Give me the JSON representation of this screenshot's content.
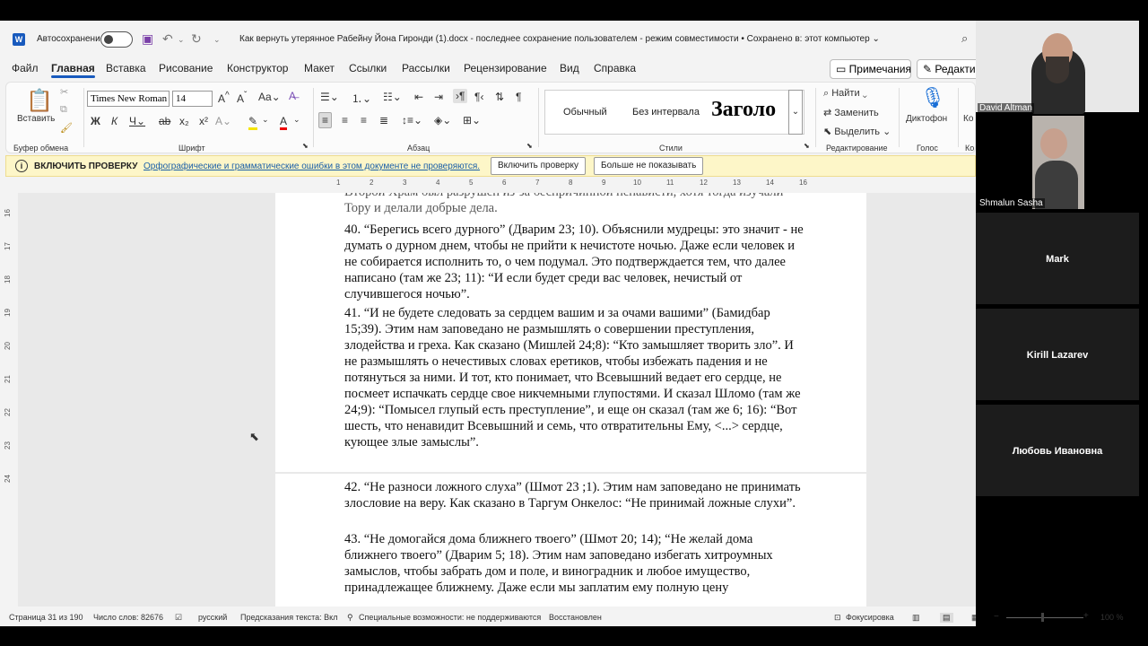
{
  "word": {
    "app_icon": "word-icon",
    "autosave_label": "Автосохранение",
    "doc_title": "Как вернуть утерянное Рабейну Йона Гиронди (1).docx  -  последнее сохранение пользователем  -  режим совместимости • Сохранено в: этот компьютер ⌄",
    "menu": [
      "Файл",
      "Главная",
      "Вставка",
      "Рисование",
      "Конструктор",
      "Макет",
      "Ссылки",
      "Рассылки",
      "Рецензирование",
      "Вид",
      "Справка"
    ],
    "notes_button": "Примечания",
    "edit_button": "Редактир",
    "ribbon": {
      "paste_label": "Вставить",
      "clipboard_group": "Буфер обмена",
      "font_group": "Шрифт",
      "paragraph_group": "Абзац",
      "styles_group": "Стили",
      "editing_group": "Редактирование",
      "voice_group": "Голос",
      "font_name": "Times New Roman",
      "font_size": "14",
      "styles": [
        "Обычный",
        "Без интервала",
        "Заголо"
      ],
      "find": "Найти",
      "replace": "Заменить",
      "select": "Выделить",
      "dictate": "Диктофон",
      "extra": "Ко",
      "extra_group": "Ко"
    },
    "infobar": {
      "title": "ВКЛЮЧИТЬ ПРОВЕРКУ",
      "text": "Орфографические и грамматические ошибки в этом документе не проверяются.",
      "enable_button": "Включить проверку",
      "dismiss_button": "Больше не показывать"
    },
    "hruler_ticks": [
      "1",
      "2",
      "3",
      "4",
      "5",
      "6",
      "7",
      "8",
      "9",
      "10",
      "11",
      "12",
      "13",
      "14",
      "15",
      "16"
    ],
    "vruler_ticks": [
      "16",
      "17",
      "18",
      "19",
      "20",
      "21",
      "22",
      "23",
      "24"
    ],
    "document": {
      "page1_top": "Второй Храм был разрушен из-за беспричинной ненависти, хотя тогда изучали Тору и делали добрые дела.",
      "p40": "40.    “Берегись всего дурного” (Дварим 23; 10). Объяснили мудрецы: это значит - не думать о дурном днем, чтобы не прийти к нечистоте ночью. Даже если человек и не собирается исполнить то, о чем подумал. Это подтверждается тем, что далее написано (там же 23; 11): “И если будет среди вас человек, нечистый от случившегося ночью”.",
      "p41": "41.    “И не будете следовать за сердцем вашим и за очами вашими” (Бамидбар 15;39). Этим нам заповедано не размышлять о совершении преступления, злодейства и греха. Как сказано (Мишлей 24;8): “Кто замышляет творить зло”. И не размышлять о нечестивых словах еретиков, чтобы избежать падения и не потянуться за ними. И тот, кто понимает, что Всевышний ведает его сердце, не посмеет испачкать сердце свое никчемными глупостями. И сказал Шломо (там же 24;9): “Помысел глупый есть преступление”, и еще он сказал (там же 6; 16): “Вот шесть, что ненавидит Всевышний и семь, что отвратительны Ему, <...> сердце, кующее злые замыслы”.",
      "p42": "42.    “Не разноси ложного слуха” (Шмот 23 ;1). Этим нам заповедано не принимать злословие на веру. Как сказано в Таргум Онкелос: “Не принимай ложные слухи”.",
      "p43": "43.    “Не домогайся дома ближнего твоего” (Шмот 20; 14); “Не желай дома ближнего твоего” (Дварим 5; 18). Этим нам заповедано избегать хитроумных замыслов, чтобы забрать дом и поле, и виноградник и любое имущество, принадлежащее ближнему. Даже если мы заплатим ему полную цену"
    },
    "status": {
      "page": "Страница 31 из 190",
      "words": "Число слов: 82676",
      "language": "русский",
      "predictions": "Предсказания текста: Вкл",
      "accessibility": "Специальные возможности: не поддерживаются",
      "restored": "Восстановлен",
      "focus": "Фокусировка",
      "zoom": "100 %"
    }
  },
  "participants": [
    {
      "name": "David Altman",
      "video": true
    },
    {
      "name": "Shmalun Sasha",
      "video": true
    },
    {
      "name": "Mark",
      "video": false
    },
    {
      "name": "Kirill Lazarev",
      "video": false
    },
    {
      "name": "Любовь Ивановна",
      "video": false
    }
  ]
}
